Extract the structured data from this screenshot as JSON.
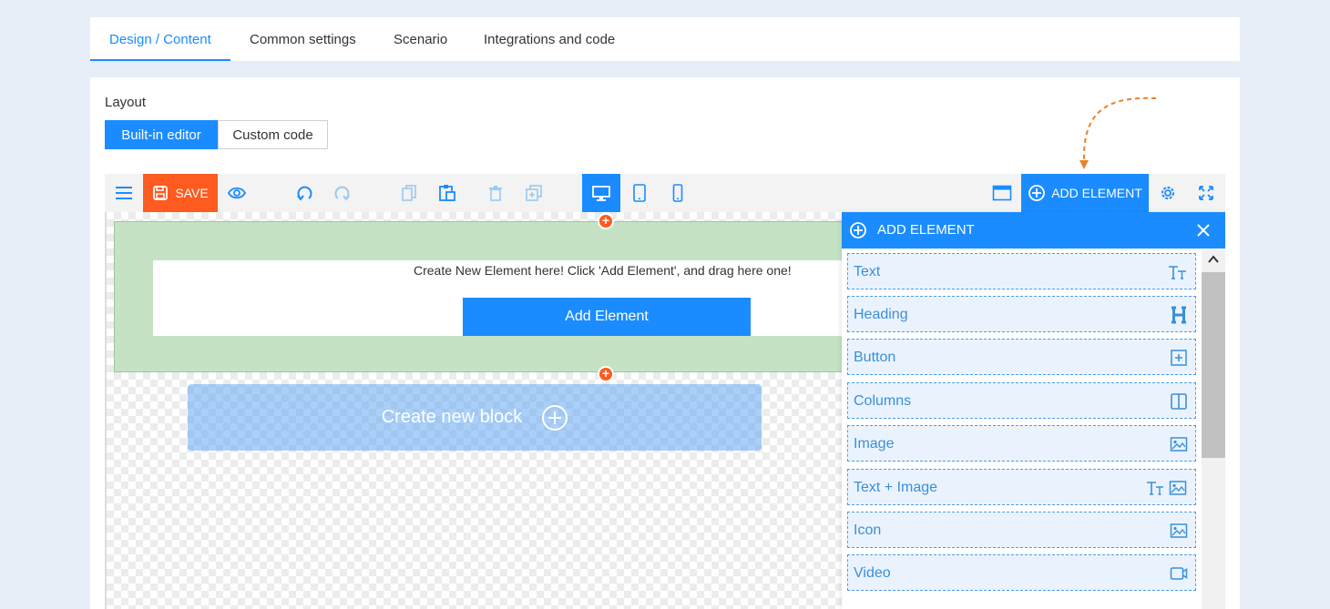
{
  "tabs": [
    {
      "label": "Design / Content"
    },
    {
      "label": "Common settings"
    },
    {
      "label": "Scenario"
    },
    {
      "label": "Integrations and code"
    }
  ],
  "layout": {
    "label": "Layout",
    "options": [
      {
        "label": "Built-in editor"
      },
      {
        "label": "Custom code"
      }
    ],
    "selected": "Built-in editor"
  },
  "toolbar": {
    "save_label": "SAVE",
    "add_element_label": "ADD ELEMENT",
    "active_device": "desktop"
  },
  "canvas": {
    "message": "Create New Element here! Click 'Add Element', and drag here one!",
    "add_button_label": "Add Element",
    "new_block_label": "Create new block"
  },
  "add_panel": {
    "title": "ADD ELEMENT",
    "items": [
      {
        "label": "Text",
        "icon": "text-icon"
      },
      {
        "label": "Heading",
        "icon": "heading-icon"
      },
      {
        "label": "Button",
        "icon": "button-icon"
      },
      {
        "label": "Columns",
        "icon": "columns-icon"
      },
      {
        "label": "Image",
        "icon": "image-icon"
      },
      {
        "label": "Text + Image",
        "icon": "text-image-icon"
      },
      {
        "label": "Icon",
        "icon": "image-icon"
      },
      {
        "label": "Video",
        "icon": "video-icon"
      }
    ]
  },
  "colors": {
    "accent": "#1a8cff",
    "save": "#ff5a1f",
    "block_green": "#c5e3c4",
    "hint_arrow": "#e8822a"
  }
}
